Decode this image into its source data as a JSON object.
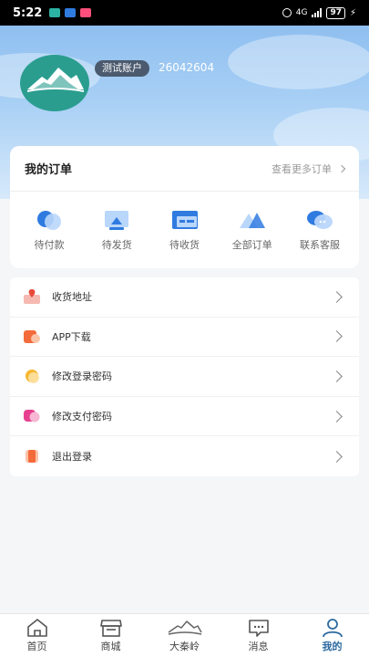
{
  "status": {
    "time": "5:22",
    "network": "4G",
    "battery": "97"
  },
  "profile": {
    "tag": "测试账户",
    "user_id": "26042604"
  },
  "orders": {
    "title": "我的订单",
    "more": "查看更多订单",
    "items": [
      {
        "label": "待付款",
        "icon": "wallet-icon"
      },
      {
        "label": "待发货",
        "icon": "box-icon"
      },
      {
        "label": "待收货",
        "icon": "truck-icon"
      },
      {
        "label": "全部订单",
        "icon": "triangle-icon"
      },
      {
        "label": "联系客服",
        "icon": "chat-icon"
      }
    ]
  },
  "menu": {
    "items": [
      {
        "label": "收货地址",
        "icon": "address-icon"
      },
      {
        "label": "APP下载",
        "icon": "download-icon"
      },
      {
        "label": "修改登录密码",
        "icon": "password-icon"
      },
      {
        "label": "修改支付密码",
        "icon": "pay-password-icon"
      },
      {
        "label": "退出登录",
        "icon": "logout-icon"
      }
    ]
  },
  "tabbar": {
    "items": [
      {
        "label": "首页",
        "icon": "home-icon"
      },
      {
        "label": "商城",
        "icon": "shop-icon"
      },
      {
        "label": "大秦岭",
        "icon": "mountain-logo-icon"
      },
      {
        "label": "消息",
        "icon": "message-icon"
      },
      {
        "label": "我的",
        "icon": "user-icon",
        "active": true
      }
    ]
  },
  "colors": {
    "accent": "#2c6aa0",
    "header_top": "#8fbff0",
    "avatar_bg": "#2a9d8f"
  }
}
